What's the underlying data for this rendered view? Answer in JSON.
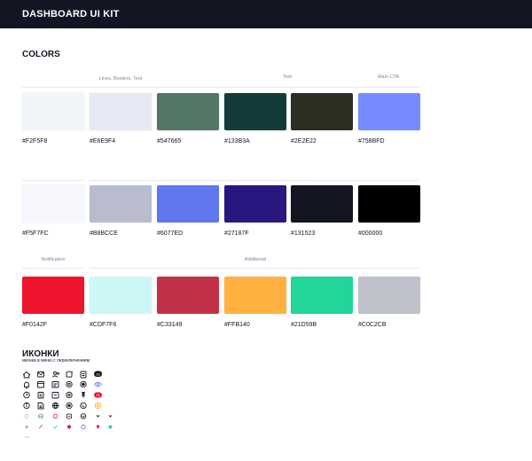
{
  "header": {
    "title": "DASHBOARD UI KIT"
  },
  "colors_section": {
    "title": "COLORS",
    "group_labels": {
      "lines": "Lines, Borders, Text",
      "text": "Text",
      "main_cta": "Main CTA",
      "notification": "Notification",
      "additional": "Additional"
    },
    "rows": [
      [
        {
          "hex": "#F2F5F8",
          "color": "#F2F5F8"
        },
        {
          "hex": "#E6E9F4",
          "color": "#E6E9F4"
        },
        {
          "hex": "#547665",
          "color": "#547665"
        },
        {
          "hex": "#133B3A",
          "color": "#133B3A"
        },
        {
          "hex": "#2E2E22",
          "color": "#2E2E22"
        },
        {
          "hex": "#758BFD",
          "color": "#758BFD"
        }
      ],
      [
        {
          "hex": "#F5F7FC",
          "color": "#F5F7FC"
        },
        {
          "hex": "#B8BCCE",
          "color": "#B8BCCE"
        },
        {
          "hex": "#6077ED",
          "color": "#6077ED"
        },
        {
          "hex": "#27187F",
          "color": "#27187F"
        },
        {
          "hex": "#131523",
          "color": "#131523"
        },
        {
          "hex": "#000000",
          "color": "#000000"
        }
      ],
      [
        {
          "hex": "#F0142F",
          "color": "#F0142F"
        },
        {
          "hex": "#CDF7F6",
          "color": "#CDF7F6"
        },
        {
          "hex": "#C33149",
          "color": "#C33149"
        },
        {
          "hex": "#FFB140",
          "color": "#FFB140"
        },
        {
          "hex": "#21D59B",
          "color": "#21D59B"
        },
        {
          "hex": "#C0C2CB",
          "color": "#C0C2CB"
        }
      ]
    ]
  },
  "icons_section": {
    "title": "ИКОНКИ",
    "subtitle": "иконка в меню с переключением",
    "icons": [
      "home-icon",
      "mail-icon",
      "users-icon",
      "refresh-icon",
      "document-icon",
      "chat-badge-icon",
      "bell-icon",
      "calendar-icon",
      "id-card-icon",
      "settings-icon",
      "settings-alt-icon",
      "eye-off-icon",
      "clock-icon",
      "copy-icon",
      "calendar-alt-icon",
      "settings-icon",
      "pin-icon",
      "badge-count-icon",
      "info-icon",
      "file-icon",
      "globe-icon",
      "image-icon",
      "whatsapp-icon",
      "gear-orange-icon",
      "dot-icon",
      "globe-small-icon",
      "contact-icon",
      "star-icon",
      "chevron-down-icon",
      "chevron-down-small-icon",
      "plus-icon",
      "arrow-icon",
      "check-icon",
      "dot-red-icon",
      "dot-blue-icon",
      "pin-small-icon",
      "dot-green-icon"
    ]
  },
  "ui_colors": {
    "topbar": "#131523",
    "label": "#7E84A3",
    "rule": "#E6E9F4"
  }
}
